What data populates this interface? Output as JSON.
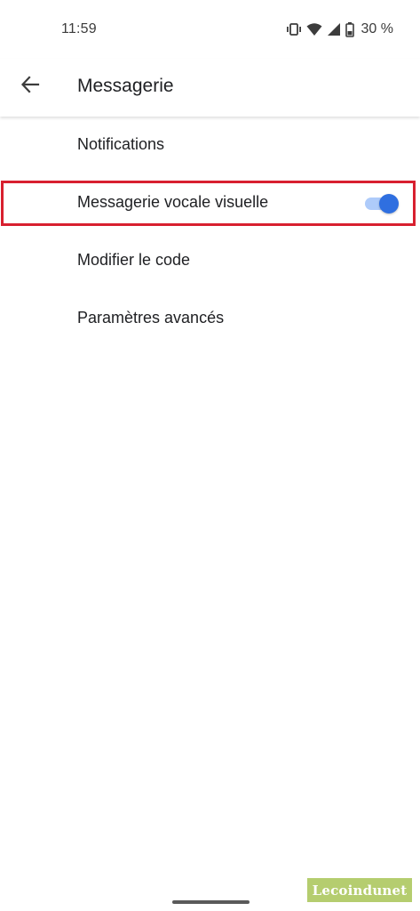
{
  "status_bar": {
    "time": "11:59",
    "battery_percent": "30 %",
    "icons": [
      "vibrate-icon",
      "wifi-icon",
      "signal-icon",
      "battery-icon"
    ]
  },
  "app_bar": {
    "title": "Messagerie",
    "back_icon": "arrow-back-icon"
  },
  "settings": {
    "items": [
      {
        "label": "Notifications"
      },
      {
        "label": "Messagerie vocale visuelle",
        "toggle_on": true
      },
      {
        "label": "Modifier le code"
      },
      {
        "label": "Paramètres avancés"
      }
    ]
  },
  "colors": {
    "accent": "#2f6fe0",
    "toggle_track": "#aecbfa",
    "highlight_border": "#d8202f",
    "watermark_bg": "#b5cd6f"
  },
  "watermark": {
    "text": "Lecoindunet"
  }
}
